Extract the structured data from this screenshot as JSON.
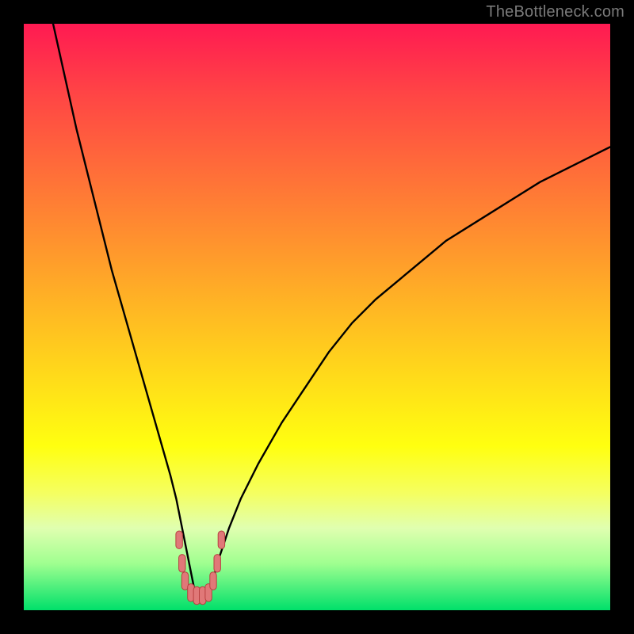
{
  "watermark": "TheBottleneck.com",
  "colors": {
    "gradient_top": "#ff1a52",
    "gradient_bottom": "#00e06a",
    "curve": "#000000",
    "marker_fill": "#e07878",
    "marker_stroke": "#b84040"
  },
  "chart_data": {
    "type": "line",
    "title": "",
    "xlabel": "",
    "ylabel": "",
    "xlim": [
      0,
      100
    ],
    "ylim": [
      0,
      100
    ],
    "grid": false,
    "series": [
      {
        "name": "curve",
        "x": [
          5,
          7,
          9,
          11,
          13,
          15,
          17,
          19,
          21,
          23,
          25,
          26,
          27,
          28,
          29,
          30,
          31,
          32,
          33,
          35,
          37,
          40,
          44,
          48,
          52,
          56,
          60,
          66,
          72,
          80,
          88,
          96,
          100
        ],
        "y": [
          100,
          91,
          82,
          74,
          66,
          58,
          51,
          44,
          37,
          30,
          23,
          19,
          14,
          9,
          4,
          2,
          2,
          4,
          8,
          14,
          19,
          25,
          32,
          38,
          44,
          49,
          53,
          58,
          63,
          68,
          73,
          77,
          79
        ]
      }
    ],
    "markers": [
      {
        "x": 26.5,
        "y": 12
      },
      {
        "x": 27.0,
        "y": 8
      },
      {
        "x": 27.5,
        "y": 5
      },
      {
        "x": 28.5,
        "y": 3
      },
      {
        "x": 29.5,
        "y": 2.5
      },
      {
        "x": 30.5,
        "y": 2.5
      },
      {
        "x": 31.5,
        "y": 3
      },
      {
        "x": 32.3,
        "y": 5
      },
      {
        "x": 33.0,
        "y": 8
      },
      {
        "x": 33.7,
        "y": 12
      }
    ]
  }
}
